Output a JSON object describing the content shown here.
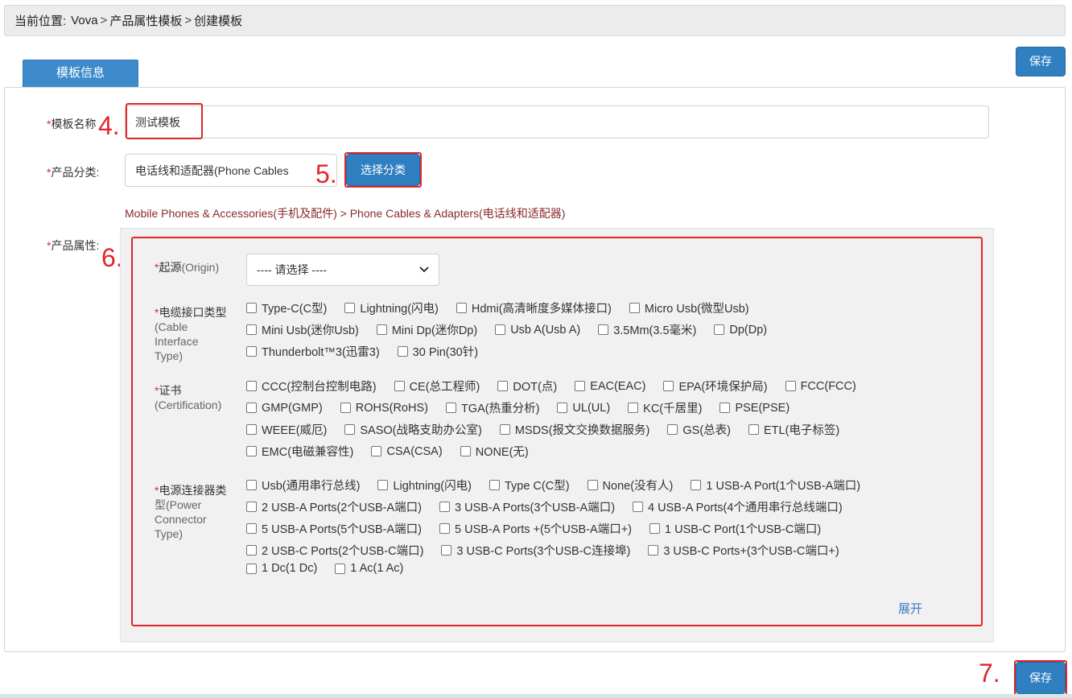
{
  "breadcrumb": {
    "prefix": "当前位置:",
    "items": [
      "Vova",
      "产品属性模板",
      "创建模板"
    ],
    "separator": ">"
  },
  "tabs": [
    {
      "label": "模板信息",
      "active": true
    }
  ],
  "buttons": {
    "save_top": "保存",
    "save_bottom": "保存",
    "choose_category": "选择分类"
  },
  "form": {
    "required_mark": "*",
    "template_name": {
      "label": "模板名称",
      "value": "测试模板"
    },
    "category": {
      "label": "产品分类:",
      "value": "电话线和适配器(Phone Cables"
    },
    "category_path": "Mobile Phones & Accessories(手机及配件)  > Phone Cables & Adapters(电话线和适配器)",
    "attributes": {
      "label": "产品属性:"
    }
  },
  "annotations": [
    "4.",
    "5.",
    "6.",
    "7."
  ],
  "attributes": {
    "origin": {
      "label_cn": "起源",
      "label_en": "(Origin)",
      "select_value": "---- 请选择 ----"
    },
    "cable_interface": {
      "label_cn": "电缆接口类型",
      "label_en_lines": [
        "(Cable",
        "Interface",
        "Type)"
      ],
      "rows": [
        [
          "Type-C(C型)",
          "Lightning(闪电)",
          "Hdmi(高清晰度多媒体接口)",
          "Micro Usb(微型Usb)"
        ],
        [
          "Mini Usb(迷你Usb)",
          "Mini Dp(迷你Dp)",
          "Usb A(Usb A)",
          "3.5Mm(3.5毫米)",
          "Dp(Dp)"
        ],
        [
          "Thunderbolt™3(迅雷3)",
          "30 Pin(30针)"
        ]
      ]
    },
    "certification": {
      "label_cn": "证书",
      "label_en_lines": [
        "(Certification)"
      ],
      "rows": [
        [
          "CCC(控制台控制电路)",
          "CE(总工程师)",
          "DOT(点)",
          "EAC(EAC)",
          "EPA(环境保护局)",
          "FCC(FCC)"
        ],
        [
          "GMP(GMP)",
          "ROHS(RoHS)",
          "TGA(热重分析)",
          "UL(UL)",
          "KC(千居里)",
          "PSE(PSE)"
        ],
        [
          "WEEE(威厄)",
          "SASO(战略支助办公室)",
          "MSDS(报文交换数据服务)",
          "GS(总表)",
          "ETL(电子标签)"
        ],
        [
          "EMC(电磁兼容性)",
          "CSA(CSA)",
          "NONE(无)"
        ]
      ]
    },
    "power_connector": {
      "label_cn_lines": [
        "电源连接器类",
        "型(Power"
      ],
      "label_en_lines": [
        "Connector",
        "Type)"
      ],
      "rows": [
        [
          "Usb(通用串行总线)",
          "Lightning(闪电)",
          "Type C(C型)",
          "None(没有人)",
          "1 USB-A Port(1个USB-A端口)"
        ],
        [
          "2 USB-A Ports(2个USB-A端口)",
          "3 USB-A Ports(3个USB-A端口)",
          "4 USB-A Ports(4个通用串行总线端口)"
        ],
        [
          "5 USB-A Ports(5个USB-A端口)",
          "5 USB-A Ports +(5个USB-A端口+)",
          "1 USB-C Port(1个USB-C端口)"
        ],
        [
          "2 USB-C Ports(2个USB-C端口)",
          "3 USB-C Ports(3个USB-C连接埠)",
          "3 USB-C Ports+(3个USB-C端口+)"
        ],
        [
          "1 Dc(1 Dc)",
          "1 Ac(1 Ac)"
        ]
      ]
    },
    "expand_label": "展开"
  },
  "colors": {
    "primary": "#2f7fc1",
    "required": "#e0262b",
    "annotation": "#e0262b",
    "link": "#3a7bc4",
    "path": "#8a2a2a"
  }
}
